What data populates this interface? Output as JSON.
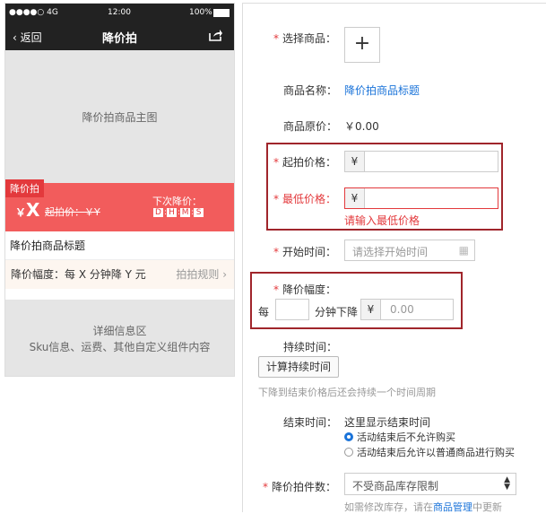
{
  "phone": {
    "status": {
      "signal": "●●●●○ 4G",
      "time": "12:00",
      "battery": "100%"
    },
    "nav": {
      "back": "返回",
      "title": "降价拍",
      "share_icon": "share-icon"
    },
    "main_image": "降价拍商品主图",
    "tag": "降价拍",
    "price_symbol": "￥",
    "price_value": "X",
    "orig_price": "起拍价：￥Y",
    "next_drop": "下次降价：",
    "countdown": [
      "D",
      "H",
      "M",
      "S"
    ],
    "product_title": "降价拍商品标题",
    "drop_info": "降价幅度：每 X 分钟降 Y 元",
    "rule_link": "拍拍规则 ›",
    "detail_title": "详细信息区",
    "detail_sub": "Sku信息、运费、其他自定义组件内容"
  },
  "form": {
    "select_goods": "选择商品：",
    "add": "+",
    "goods_name_label": "商品名称：",
    "goods_name": "降价拍商品标题",
    "orig_price_label": "商品原价：",
    "orig_price": "￥0.00",
    "start_price_label": "起拍价格：",
    "min_price_label": "最低价格：",
    "yen": "¥",
    "min_price_error": "请输入最低价格",
    "start_time_label": "开始时间：",
    "start_time_placeholder": "请选择开始时间",
    "drop_label": "降价幅度：",
    "per": "每",
    "minutes_drop": "分钟下降",
    "drop_placeholder": "0.00",
    "duration_label": "持续时间：",
    "calc_button": "计算持续时间",
    "duration_hint": "下降到结束价格后还会持续一个时间周期",
    "end_time_label": "结束时间：",
    "end_time_text": "这里显示结束时间",
    "radio1": "活动结束后不允许购买",
    "radio2": "活动结束后允许以普通商品进行购买",
    "qty_label": "降价拍件数：",
    "qty_value": "不受商品库存限制",
    "stock_hint_a": "如需修改库存，请在",
    "stock_hint_link": "商品管理",
    "stock_hint_b": "中更新"
  }
}
